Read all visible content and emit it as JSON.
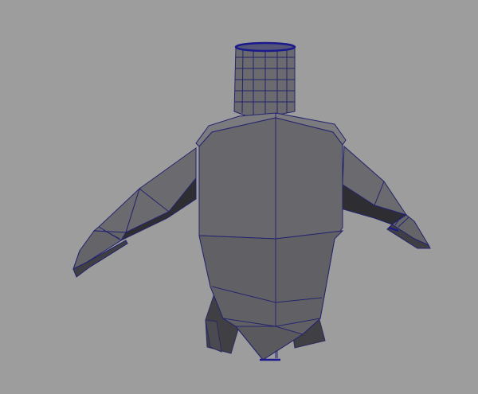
{
  "viewport": {
    "background": "#9d9d9d",
    "shading": "smooth-shade-wireframe-on-shaded",
    "selection_highlight_color": "#1a1a8c"
  },
  "mesh": {
    "object": "torso-mesh",
    "face_color": "#5e5e62",
    "wire_color": "#24246e",
    "parts": [
      "neck",
      "torso",
      "left-arm",
      "right-arm",
      "left-hip",
      "right-hip"
    ]
  }
}
